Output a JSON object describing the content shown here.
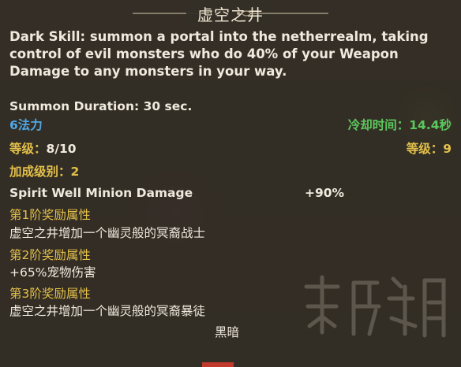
{
  "skill": {
    "title": "虚空之井",
    "description": "Dark Skill: summon a portal into the netherrealm, taking control of evil monsters who do 40% of your Weapon Damage to any monsters in your way.",
    "summon_duration": "Summon Duration: 30 sec.",
    "mana_cost": "6法力",
    "cooldown_label": "冷却时间：",
    "cooldown_value": "14.4秒",
    "level_label": "等级：",
    "level_current": "8",
    "level_max": "/10",
    "req_level": "等级：9",
    "bonus_rank": "加成级别：2",
    "stat_name": "Spirit Well Minion Damage",
    "stat_value": "+90%",
    "tier1_label": "第1阶奖励属性",
    "tier1_text": "虚空之井增加一个幽灵般的冥裔战士",
    "tier2_label": "第2阶奖励属性",
    "tier2_text": "+65%宠物伤害",
    "tier3_label": "第3阶奖励属性",
    "tier3_text": "虚空之井增加一个幽灵般的冥裔暴徒",
    "element": "黑暗"
  },
  "colors": {
    "title": "#f1e7d3",
    "text": "#efe9de",
    "mana": "#4fa8e8",
    "cooldown": "#5cc85c",
    "gold": "#e3c04a"
  }
}
